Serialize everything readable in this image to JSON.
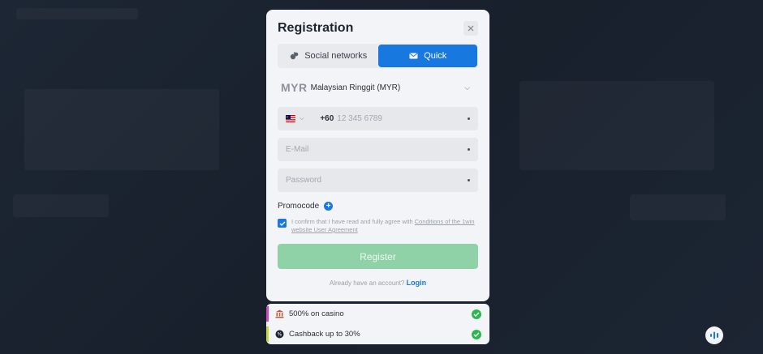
{
  "modal": {
    "title": "Registration",
    "close_icon": "close-icon"
  },
  "tabs": [
    {
      "label": "Social networks",
      "icon": "social-icon",
      "active": false
    },
    {
      "label": "Quick",
      "icon": "mail-icon",
      "active": true
    }
  ],
  "currency": {
    "code": "MYR",
    "name": "Malaysian Ringgit (MYR)"
  },
  "phone": {
    "country_code": "+60",
    "placeholder": "12 345 6789",
    "flag_icon": "malaysia-flag-icon"
  },
  "email": {
    "placeholder": "E-Mail"
  },
  "password": {
    "placeholder": "Password"
  },
  "promo": {
    "label": "Promocode"
  },
  "agreement": {
    "text": "I confirm that I have read and fully agree with",
    "link": "Conditions of the 1win website User Agreement"
  },
  "register": {
    "label": "Register"
  },
  "login": {
    "prompt": "Already have an account?",
    "link": "Login"
  },
  "bonuses": [
    {
      "label": "500% on casino",
      "icon": "casino-icon",
      "accent": "#c74ac1"
    },
    {
      "label": "Cashback up to 30%",
      "icon": "cashback-icon",
      "accent": "#c6d93a"
    }
  ],
  "colors": {
    "accent": "#1779e0",
    "register_button": "#8fd2a8",
    "check_green": "#2db84f"
  }
}
